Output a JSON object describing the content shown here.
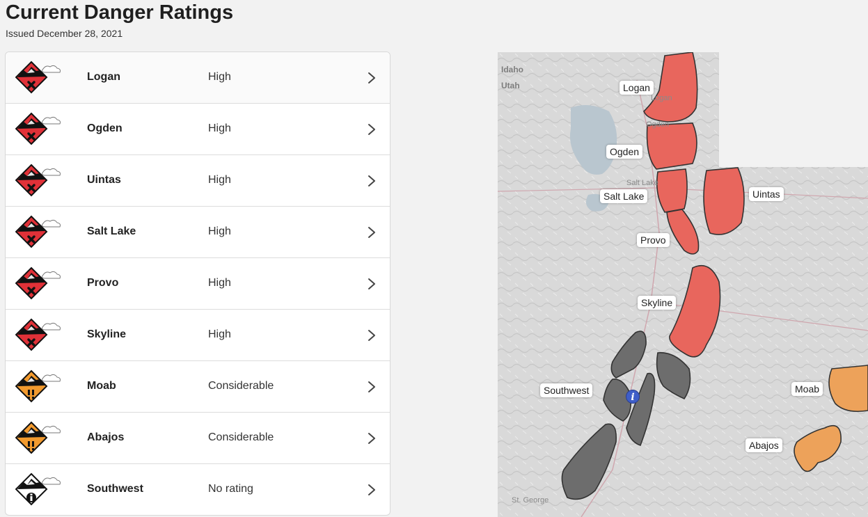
{
  "page": {
    "title": "Current Danger Ratings",
    "issued": "Issued December 28, 2021"
  },
  "colors": {
    "high": "#e03138",
    "considerable": "#f29a2e",
    "no_rating": "#ffffff",
    "high_map_fill": "#e8665d",
    "considerable_map_fill": "#eda25a",
    "no_rating_map_fill": "#6d6d6d"
  },
  "regions": [
    {
      "name": "Logan",
      "rating": "High",
      "icon": "danger-high-icon"
    },
    {
      "name": "Ogden",
      "rating": "High",
      "icon": "danger-high-icon"
    },
    {
      "name": "Uintas",
      "rating": "High",
      "icon": "danger-high-icon"
    },
    {
      "name": "Salt Lake",
      "rating": "High",
      "icon": "danger-high-icon"
    },
    {
      "name": "Provo",
      "rating": "High",
      "icon": "danger-high-icon"
    },
    {
      "name": "Skyline",
      "rating": "High",
      "icon": "danger-high-icon"
    },
    {
      "name": "Moab",
      "rating": "Considerable",
      "icon": "danger-considerable-icon"
    },
    {
      "name": "Abajos",
      "rating": "Considerable",
      "icon": "danger-considerable-icon"
    },
    {
      "name": "Southwest",
      "rating": "No rating",
      "icon": "danger-no-rating-icon"
    }
  ],
  "map": {
    "state_labels": [
      "Idaho",
      "Utah"
    ],
    "city_labels": [
      "Logan",
      "Ogden",
      "Salt Lake",
      "St. George"
    ],
    "info_marker": "i",
    "region_labels": [
      "Logan",
      "Ogden",
      "Salt Lake",
      "Uintas",
      "Provo",
      "Skyline",
      "Southwest",
      "Moab",
      "Abajos"
    ]
  }
}
